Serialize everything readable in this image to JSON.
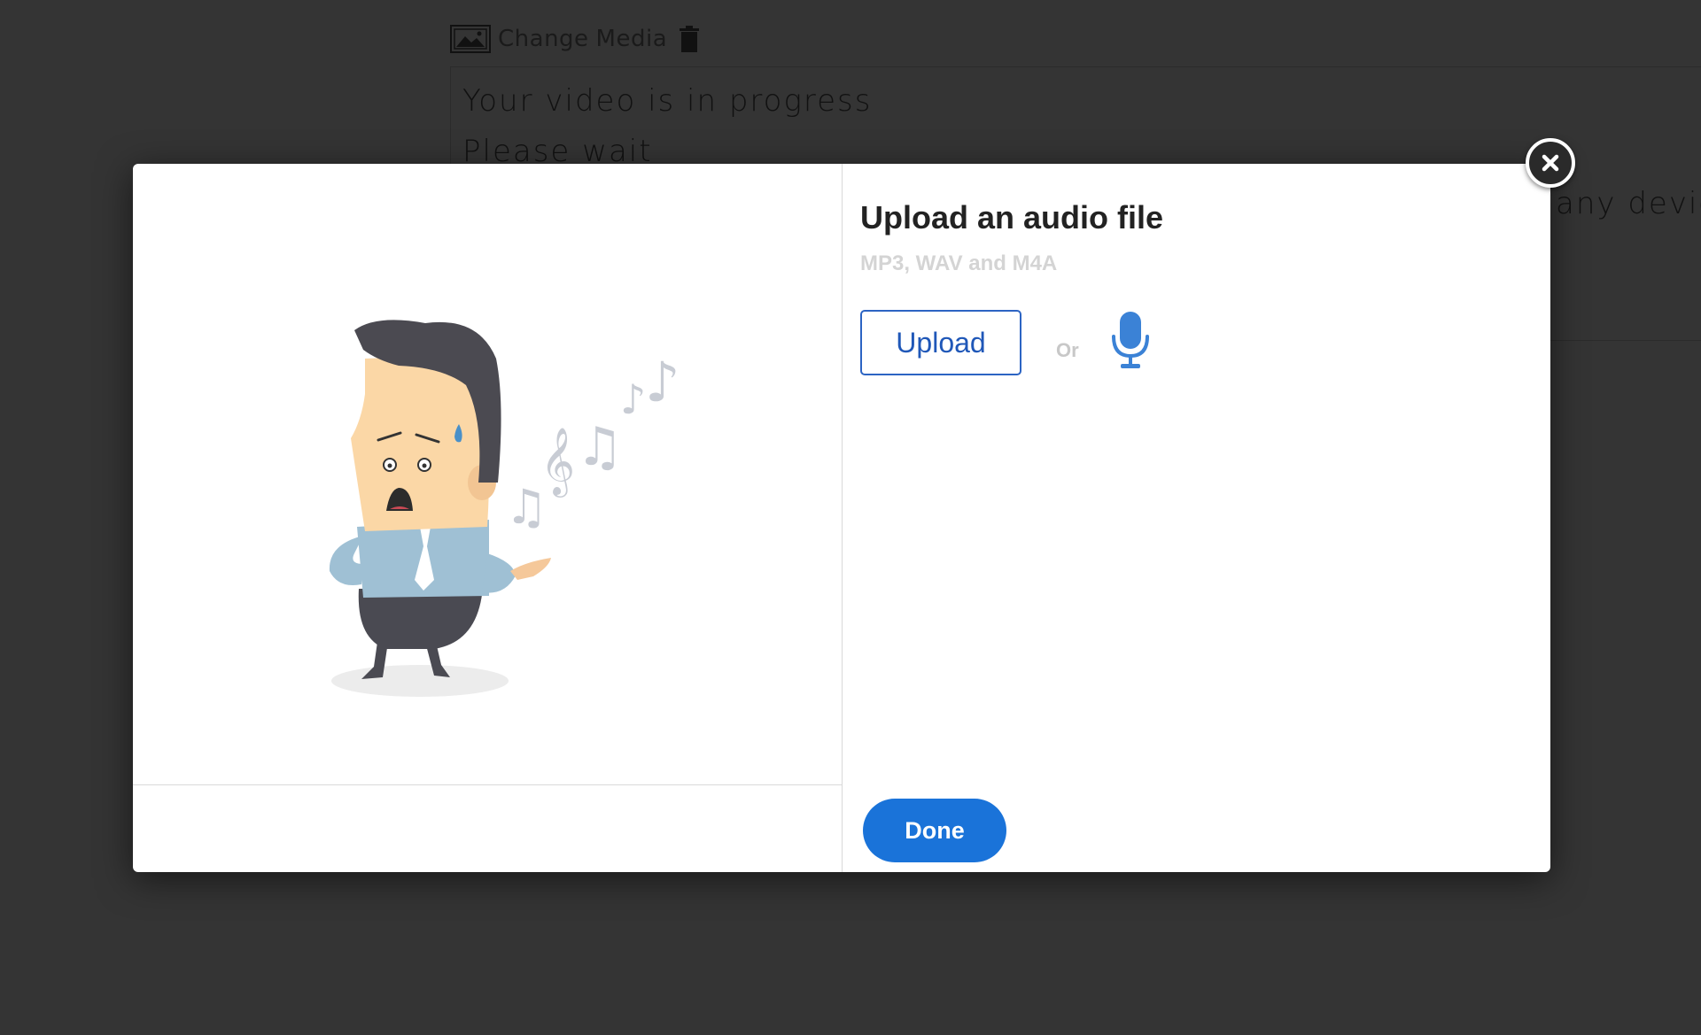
{
  "background": {
    "toolbar": {
      "media_icon": "image-icon",
      "change_label": "Change",
      "media_label": "Media",
      "trash_icon": "trash-icon"
    },
    "progress_line": "Your video is in progress",
    "wait_line": "Please wait",
    "partial_text": "any device"
  },
  "modal": {
    "illustration": "singing-man-illustration",
    "title": "Upload an audio file",
    "subtitle": "MP3, WAV and M4A",
    "upload_label": "Upload",
    "or_label": "Or",
    "mic_icon": "microphone-icon",
    "done_label": "Done",
    "close_icon": "close-icon"
  },
  "colors": {
    "backdrop": "#343434",
    "accent": "#1a73d9",
    "upload_border": "#2c64c3",
    "mic": "#3b82d6"
  }
}
